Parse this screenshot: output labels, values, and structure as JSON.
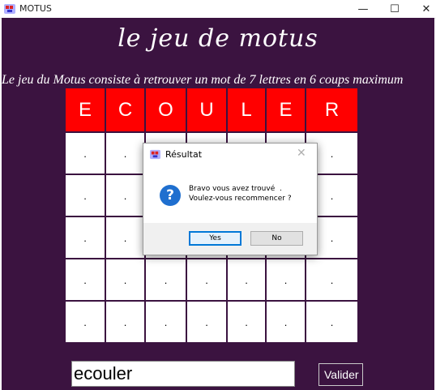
{
  "window": {
    "title": "MOTUS",
    "controls": {
      "minimize": "—",
      "maximize": "☐",
      "close": "✕"
    }
  },
  "game": {
    "title": "le jeu de motus",
    "subtitle": "Le jeu du Motus consiste à retrouver un mot de 7 lettres en 6 coups maximum",
    "grid": [
      [
        "E",
        "C",
        "O",
        "U",
        "L",
        "E",
        "R"
      ],
      [
        ".",
        ".",
        ".",
        ".",
        ".",
        ".",
        "."
      ],
      [
        ".",
        ".",
        ".",
        ".",
        ".",
        ".",
        "."
      ],
      [
        ".",
        ".",
        ".",
        ".",
        ".",
        ".",
        "."
      ],
      [
        ".",
        ".",
        ".",
        ".",
        ".",
        ".",
        "."
      ],
      [
        ".",
        ".",
        ".",
        ".",
        ".",
        ".",
        "."
      ]
    ],
    "input_value": "ecouler",
    "validate_label": "Valider"
  },
  "dialog": {
    "title": "Résultat",
    "close": "✕",
    "message_line1": "Bravo vous avez trouvé  .",
    "message_line2": "Voulez-vous recommencer ?",
    "yes_label": "Yes",
    "no_label": "No",
    "icon": "question-icon"
  },
  "colors": {
    "background": "#3b1340",
    "correct_letter": "#ff0000",
    "accent": "#0078d7"
  }
}
